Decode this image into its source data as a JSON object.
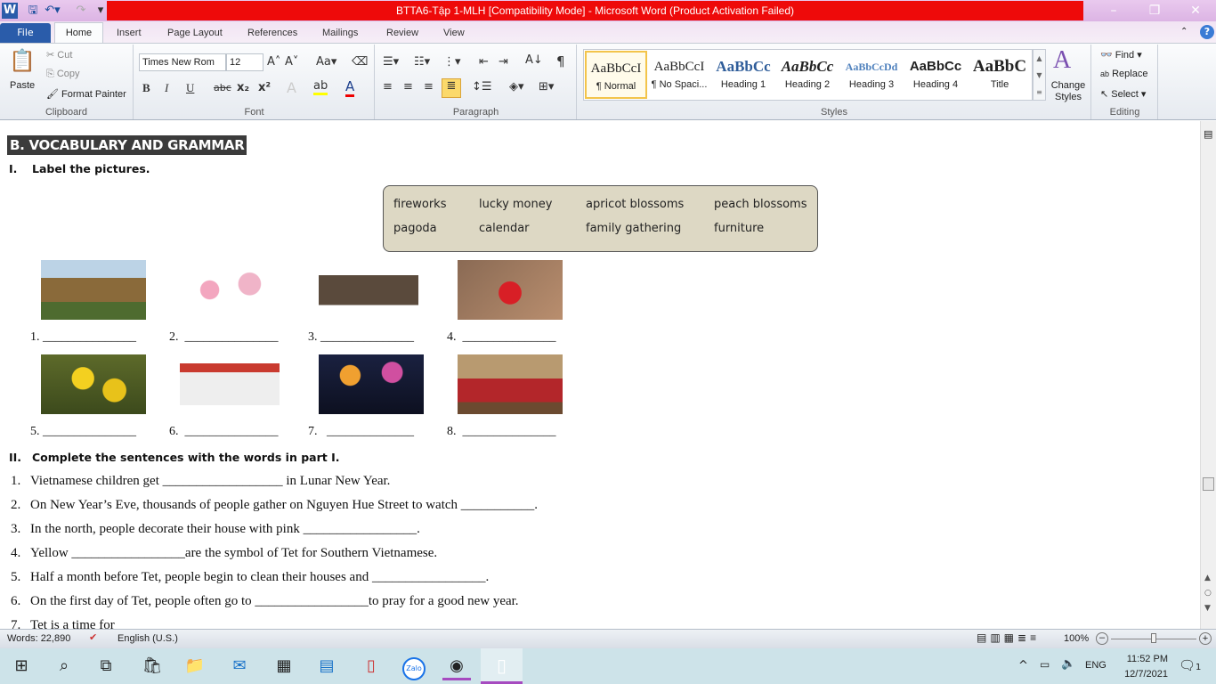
{
  "window": {
    "title": "BTTA6-Tập 1-MLH [Compatibility Mode]  -  Microsoft Word (Product Activation Failed)",
    "app_icon": "W"
  },
  "tabs": [
    "File",
    "Home",
    "Insert",
    "Page Layout",
    "References",
    "Mailings",
    "Review",
    "View"
  ],
  "clipboard": {
    "paste": "Paste",
    "cut": "Cut",
    "copy": "Copy",
    "format_painter": "Format Painter",
    "label": "Clipboard"
  },
  "font": {
    "name": "Times New Rom",
    "size": "12",
    "label": "Font",
    "bold": "B",
    "italic": "I",
    "underline": "U",
    "strike": "abc",
    "sub": "x₂",
    "sup": "x²"
  },
  "paragraph": {
    "label": "Paragraph"
  },
  "styles": {
    "label": "Styles",
    "items": [
      {
        "preview": "AaBbCcI",
        "name": "¶ Normal"
      },
      {
        "preview": "AaBbCcI",
        "name": "¶ No Spaci..."
      },
      {
        "preview": "AaBbCc",
        "name": "Heading 1"
      },
      {
        "preview": "AaBbCc",
        "name": "Heading 2"
      },
      {
        "preview": "AaBbCcDd",
        "name": "Heading 3"
      },
      {
        "preview": "AaBbCc",
        "name": "Heading 4"
      },
      {
        "preview": "AaBbC",
        "name": "Title"
      }
    ],
    "change_styles": "Change Styles"
  },
  "editing": {
    "label": "Editing",
    "find": "Find",
    "replace": "Replace",
    "select": "Select"
  },
  "document": {
    "heading": "B.  VOCABULARY AND GRAMMAR",
    "section1": {
      "num": "I.",
      "title": "Label the pictures."
    },
    "words": [
      [
        "fireworks",
        "lucky money",
        "apricot blossoms",
        "peach blossoms"
      ],
      [
        "pagoda",
        "calendar",
        "family gathering",
        "furniture"
      ]
    ],
    "labels": [
      "1. _______________",
      "2.  _______________",
      "3. _______________",
      "4.  _______________",
      "5. _______________",
      "6.  _______________",
      "7.   ______________",
      "8.  _______________"
    ],
    "pictures": [
      "pagoda",
      "peach-blossoms",
      "furniture",
      "lucky-money",
      "apricot-blossoms",
      "calendar",
      "fireworks",
      "family-gathering"
    ],
    "section2": {
      "num": "II.",
      "title": "Complete the sentences with the words in part I."
    },
    "sentences": [
      {
        "n": "1.",
        "t": "Vietnamese children get __________________ in Lunar New Year."
      },
      {
        "n": "2.",
        "t": "On New Year’s Eve, thousands of people gather on Nguyen Hue Street to watch ___________."
      },
      {
        "n": "3.",
        "t": "In the north, people decorate their house with pink _________________."
      },
      {
        "n": "4.",
        "t": "Yellow _________________are the symbol of Tet for Southern Vietnamese."
      },
      {
        "n": "5.",
        "t": "Half a month before Tet, people begin to clean their houses and _________________."
      },
      {
        "n": "6.",
        "t": "On the first day of Tet, people often go to _________________to pray for a good new year."
      },
      {
        "n": "7.",
        "t": "Tet is a time for"
      }
    ]
  },
  "status": {
    "words": "Words: 22,890",
    "language": "English (U.S.)",
    "zoom": "100%",
    "zoom_level": 100
  },
  "taskbar": {
    "time": "11:52 PM",
    "date": "12/7/2021",
    "lang": "ENG",
    "notifications": "1",
    "zalo": "Zalo"
  }
}
